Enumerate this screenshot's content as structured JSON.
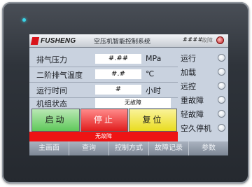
{
  "header": {
    "brand": "FUSHENG",
    "title": "空压机智能控制系统",
    "user_code": "####",
    "fault_label": "故障"
  },
  "readings": [
    {
      "label": "排气压力",
      "value": "#.##",
      "unit": "MPa"
    },
    {
      "label": "二阶排气温度",
      "value": "#.#",
      "unit": "℃"
    },
    {
      "label": "运行时间",
      "value": "#",
      "unit": "小时"
    },
    {
      "label": "机组状态",
      "value": "无故障",
      "unit": ""
    }
  ],
  "status_indicators": [
    {
      "label": "运行"
    },
    {
      "label": "加载"
    },
    {
      "label": "远控"
    },
    {
      "label": "重故障"
    },
    {
      "label": "轻故障"
    },
    {
      "label": "空久停机"
    }
  ],
  "controls": {
    "start": "启动",
    "stop": "停止",
    "reset": "复位"
  },
  "alarm_bar": {
    "text": "无故障"
  },
  "nav": [
    {
      "label": "主画面"
    },
    {
      "label": "查询"
    },
    {
      "label": "控制方式"
    },
    {
      "label": "故障记录"
    },
    {
      "label": "参数"
    }
  ],
  "colors": {
    "start": "#5fc85a",
    "stop": "#e11d1d",
    "reset": "#e9dc1f",
    "alarm": "#ee1414",
    "led": "#39d5e8"
  }
}
